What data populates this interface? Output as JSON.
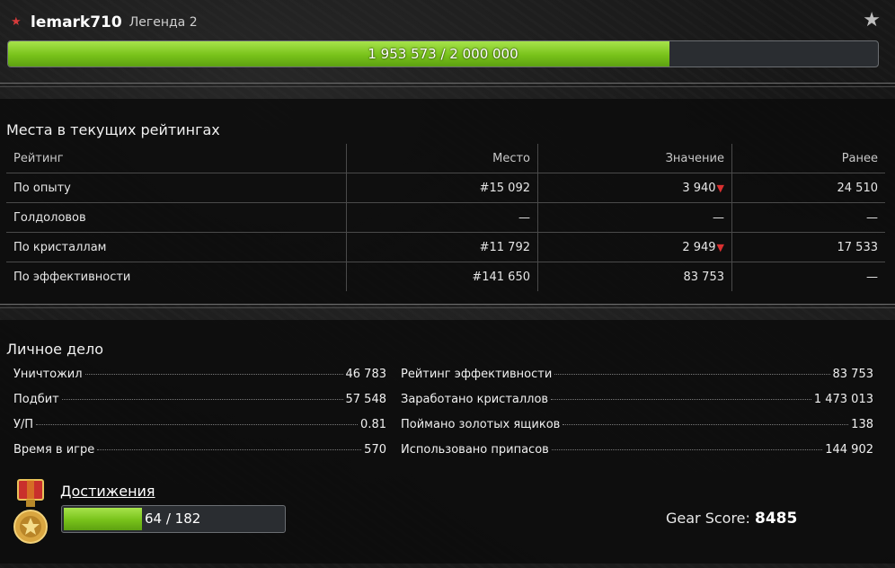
{
  "profile": {
    "username": "lemark710",
    "rank_name": "Легенда 2",
    "rank_icon": "red-star-icon",
    "favorite_icon": "star-icon",
    "xp_text": "1 953 573 / 2 000 000",
    "xp_current": 1953573,
    "xp_max": 2000000
  },
  "ratings": {
    "title": "Места в текущих рейтингах",
    "columns": [
      "Рейтинг",
      "Место",
      "Значение",
      "Ранее"
    ],
    "rows": [
      {
        "name": "По опыту",
        "place": "#15 092",
        "value": "3 940",
        "trend": "down",
        "prev": "24 510"
      },
      {
        "name": "Голдоловов",
        "place": "—",
        "value": "—",
        "trend": "",
        "prev": "—"
      },
      {
        "name": "По кристаллам",
        "place": "#11 792",
        "value": "2 949",
        "trend": "down",
        "prev": "17 533"
      },
      {
        "name": "По эффективности",
        "place": "#141 650",
        "value": "83 753",
        "trend": "",
        "prev": "—"
      }
    ],
    "trend_down_symbol": "▼"
  },
  "personal": {
    "title": "Личное дело",
    "left": [
      {
        "label": "Уничтожил",
        "value": "46 783"
      },
      {
        "label": "Подбит",
        "value": "57 548"
      },
      {
        "label": "У/П",
        "value": "0.81"
      },
      {
        "label": "Время в игре",
        "value": "570"
      }
    ],
    "right": [
      {
        "label": "Рейтинг эффективности",
        "value": "83 753"
      },
      {
        "label": "Заработано кристаллов",
        "value": "1 473 013"
      },
      {
        "label": "Поймано золотых ящиков",
        "value": "138"
      },
      {
        "label": "Использовано припасов",
        "value": "144 902"
      }
    ]
  },
  "achievements": {
    "link_label": "Достижения",
    "progress_text": "64 / 182",
    "current": 64,
    "total": 182,
    "medal_icon": "medal-icon"
  },
  "gear": {
    "label": "Gear Score:",
    "value": "8485"
  }
}
